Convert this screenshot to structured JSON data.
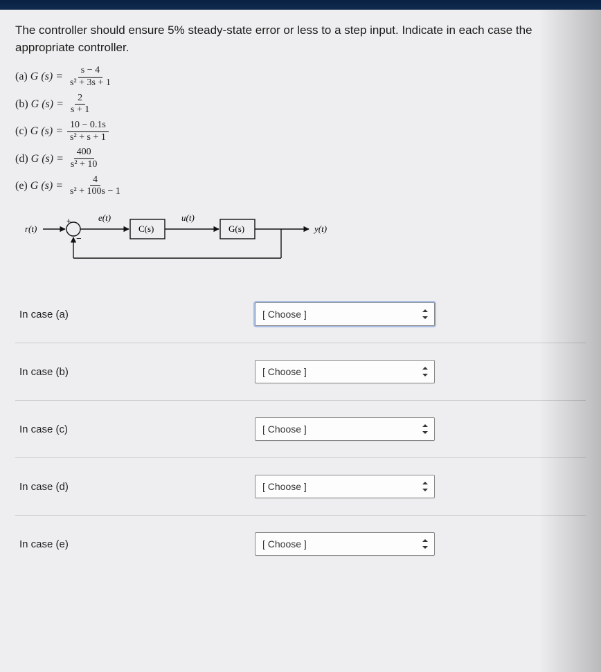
{
  "question": {
    "prompt": "The controller should ensure 5% steady-state error or less to a step input. Indicate in each case the appropriate controller.",
    "options": {
      "a": {
        "label": "(a)",
        "lhs": "G (s) =",
        "num": "s − 4",
        "den": "s² + 3s + 1"
      },
      "b": {
        "label": "(b)",
        "lhs": "G (s) =",
        "num": "2",
        "den": "s + 1"
      },
      "c": {
        "label": "(c)",
        "lhs": "G (s) =",
        "num": "10 − 0.1s",
        "den": "s² + s + 1"
      },
      "d": {
        "label": "(d)",
        "lhs": "G (s) =",
        "num": "400",
        "den": "s² + 10"
      },
      "e": {
        "label": "(e)",
        "lhs": "G (s) =",
        "num": "4",
        "den": "s² + 100s − 1"
      }
    }
  },
  "diagram": {
    "r": "r(t)",
    "plus": "+",
    "minus": "−",
    "e": "e(t)",
    "c_block": "C(s)",
    "u": "u(t)",
    "g_block": "G(s)",
    "y": "y(t)"
  },
  "answers": [
    {
      "label": "In case (a)",
      "placeholder": "[ Choose ]",
      "highlight": true
    },
    {
      "label": "In case (b)",
      "placeholder": "[ Choose ]",
      "highlight": false
    },
    {
      "label": "In case (c)",
      "placeholder": "[ Choose ]",
      "highlight": false
    },
    {
      "label": "In case (d)",
      "placeholder": "[ Choose ]",
      "highlight": false
    },
    {
      "label": "In case (e)",
      "placeholder": "[ Choose ]",
      "highlight": false
    }
  ]
}
